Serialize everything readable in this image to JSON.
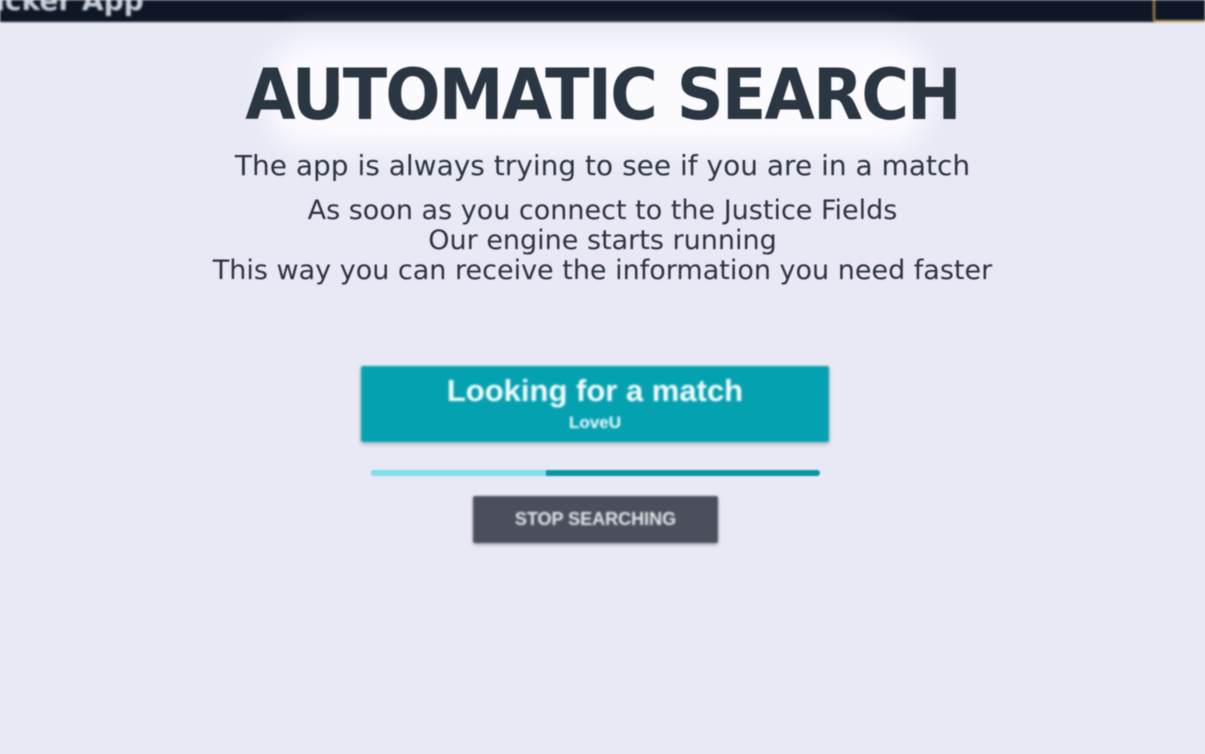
{
  "app": {
    "title": "acker App"
  },
  "colors": {
    "background": "#e8e9f4",
    "topbar": "#0e1726",
    "accent": "#04a1b1",
    "progress_fill": "#7fdfeb",
    "stop_button": "#4b4f5d",
    "corner_border": "#b3934a"
  },
  "main": {
    "title": "AUTOMATIC SEARCH",
    "subtitle": "The app is always trying to see if you are in a match",
    "description": [
      "As soon as you connect to the Justice Fields",
      "Our engine starts running",
      "This way you can receive the information you need faster"
    ]
  },
  "match_button": {
    "title": "Looking for a match",
    "user": "LoveU"
  },
  "progress": {
    "value": 0.39
  },
  "stop_button": {
    "label": "STOP SEARCHING"
  }
}
